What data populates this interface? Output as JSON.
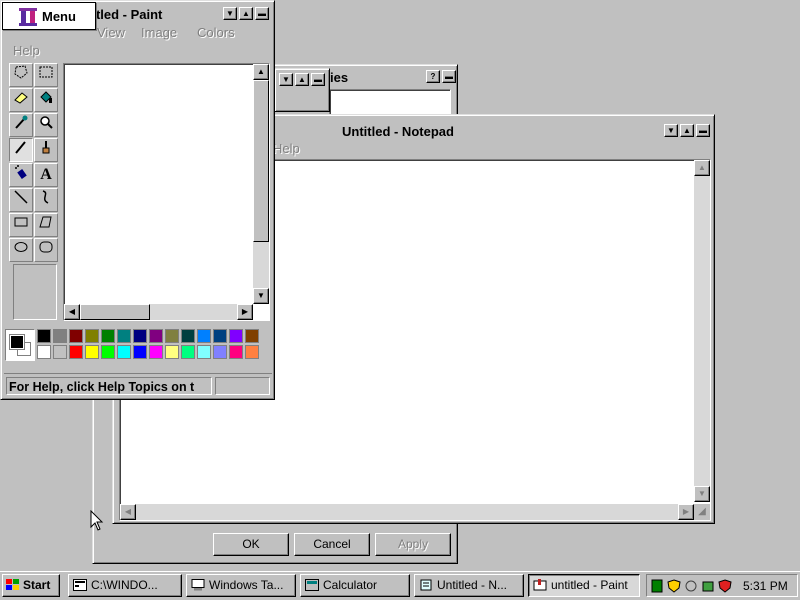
{
  "properties_window": {
    "title": "ies",
    "ok_label": "OK",
    "cancel_label": "Cancel",
    "apply_label": "Apply"
  },
  "notepad": {
    "title": "Untitled - Notepad",
    "menu_help": "Help"
  },
  "paint": {
    "title": "titled - Paint",
    "menu": [
      "View",
      "Image",
      "Colors"
    ],
    "menu_help": "Help",
    "status": "For Help, click Help Topics on t",
    "tools": [
      "free-select",
      "rect-select",
      "eraser",
      "fill",
      "color-picker",
      "magnifier",
      "pencil",
      "brush",
      "airbrush",
      "text",
      "line",
      "curve",
      "rectangle",
      "polygon",
      "ellipse",
      "rounded-rect"
    ],
    "text_tool_glyph": "A",
    "palette_top": [
      "#000000",
      "#808080",
      "#800000",
      "#808000",
      "#008000",
      "#008080",
      "#000080",
      "#800080",
      "#808040",
      "#004040",
      "#0080ff",
      "#004080",
      "#8000ff",
      "#804000"
    ],
    "palette_bottom": [
      "#ffffff",
      "#c0c0c0",
      "#ff0000",
      "#ffff00",
      "#00ff00",
      "#00ffff",
      "#0000ff",
      "#ff00ff",
      "#ffff80",
      "#00ff80",
      "#80ffff",
      "#8080ff",
      "#ff0080",
      "#ff8040"
    ],
    "fg_color": "#000000",
    "bg_color": "#ffffff"
  },
  "menu_popup": {
    "label": "Menu"
  },
  "taskbar": {
    "start_label": "Start",
    "tasks": [
      {
        "label": "C:\\WINDO...",
        "icon": "console-icon"
      },
      {
        "label": "Windows Ta...",
        "icon": "computer-icon"
      },
      {
        "label": "Calculator",
        "icon": "calculator-icon"
      },
      {
        "label": "Untitled - N...",
        "icon": "notepad-icon"
      },
      {
        "label": "untitled - Paint",
        "icon": "paint-icon"
      }
    ],
    "clock": "5:31 PM"
  }
}
